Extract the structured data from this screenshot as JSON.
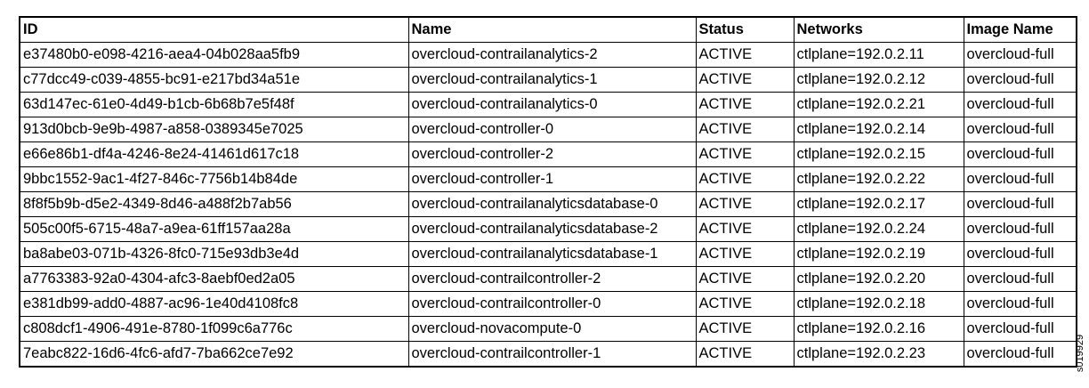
{
  "table": {
    "headers": [
      "ID",
      "Name",
      "Status",
      "Networks",
      "Image Name"
    ],
    "rows": [
      [
        "e37480b0-e098-4216-aea4-04b028aa5fb9",
        "overcloud-contrailanalytics-2",
        "ACTIVE",
        "ctlplane=192.0.2.11",
        "overcloud-full"
      ],
      [
        "c77dcc49-c039-4855-bc91-e217bd34a51e",
        "overcloud-contrailanalytics-1",
        "ACTIVE",
        "ctlplane=192.0.2.12",
        "overcloud-full"
      ],
      [
        "63d147ec-61e0-4d49-b1cb-6b68b7e5f48f",
        "overcloud-contrailanalytics-0",
        "ACTIVE",
        "ctlplane=192.0.2.21",
        "overcloud-full"
      ],
      [
        "913d0bcb-9e9b-4987-a858-0389345e7025",
        "overcloud-controller-0",
        "ACTIVE",
        "ctlplane=192.0.2.14",
        "overcloud-full"
      ],
      [
        "e66e86b1-df4a-4246-8e24-41461d617c18",
        "overcloud-controller-2",
        "ACTIVE",
        "ctlplane=192.0.2.15",
        "overcloud-full"
      ],
      [
        "9bbc1552-9ac1-4f27-846c-7756b14b84de",
        "overcloud-controller-1",
        "ACTIVE",
        "ctlplane=192.0.2.22",
        "overcloud-full"
      ],
      [
        "8f8f5b9b-d5e2-4349-8d46-a488f2b7ab56",
        "overcloud-contrailanalyticsdatabase-0",
        "ACTIVE",
        "ctlplane=192.0.2.17",
        "overcloud-full"
      ],
      [
        "505c00f5-6715-48a7-a9ea-61ff157aa28a",
        "overcloud-contrailanalyticsdatabase-2",
        "ACTIVE",
        "ctlplane=192.0.2.24",
        "overcloud-full"
      ],
      [
        "ba8abe03-071b-4326-8fc0-715e93db3e4d",
        "overcloud-contrailanalyticsdatabase-1",
        "ACTIVE",
        "ctlplane=192.0.2.19",
        "overcloud-full"
      ],
      [
        "a7763383-92a0-4304-afc3-8aebf0ed2a05",
        "overcloud-contrailcontroller-2",
        "ACTIVE",
        "ctlplane=192.0.2.20",
        "overcloud-full"
      ],
      [
        "e381db99-add0-4887-ac96-1e40d4108fc8",
        "overcloud-contrailcontroller-0",
        "ACTIVE",
        "ctlplane=192.0.2.18",
        "overcloud-full"
      ],
      [
        "c808dcf1-4906-491e-8780-1f099c6a776c",
        "overcloud-novacompute-0",
        "ACTIVE",
        "ctlplane=192.0.2.16",
        "overcloud-full"
      ],
      [
        "7eabc822-16d6-4fc6-afd7-7ba662ce7e92",
        "overcloud-contrailcontroller-1",
        "ACTIVE",
        "ctlplane=192.0.2.23",
        "overcloud-full"
      ]
    ]
  },
  "figure_id": "s019929"
}
